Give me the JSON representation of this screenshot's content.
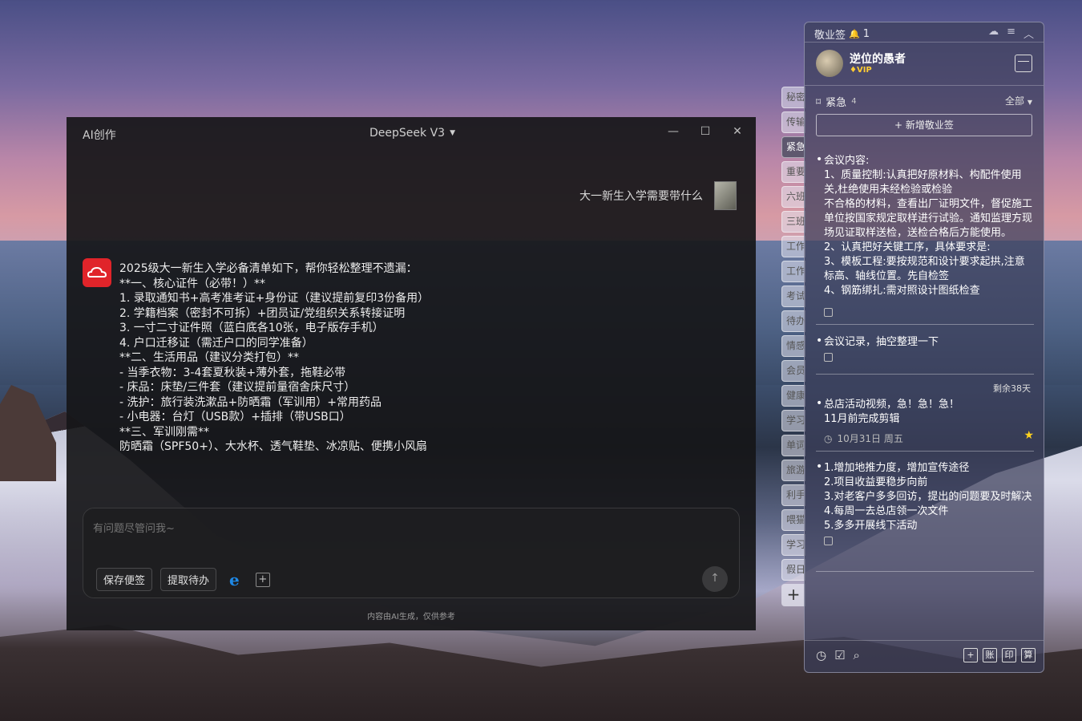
{
  "ai_window": {
    "title": "AI创作",
    "model": "DeepSeek V3",
    "user_message": "大一新生入学需要带什么",
    "response_lines": [
      "2025级大一新生入学必备清单如下，帮你轻松整理不遗漏：",
      "",
      "**一、核心证件（必带！）**",
      "1. 录取通知书+高考准考证+身份证（建议提前复印3份备用）",
      "2. 学籍档案（密封不可拆）+团员证/党组织关系转接证明",
      "3. 一寸二寸证件照（蓝白底各10张，电子版存手机）",
      "4. 户口迁移证（需迁户口的同学准备）",
      "",
      "**二、生活用品（建议分类打包）**",
      "- 当季衣物：3-4套夏秋装+薄外套，拖鞋必带",
      "- 床品：床垫/三件套（建议提前量宿舍床尺寸）",
      "- 洗护：旅行装洗漱品+防晒霜（军训用）+常用药品",
      "- 小电器：台灯（USB款）+插排（带USB口）",
      "",
      "**三、军训刚需**",
      "防晒霜（SPF50+）、大水杯、透气鞋垫、冰凉贴、便携小风扇"
    ],
    "input_placeholder": "有问题尽管问我~",
    "btn_save": "保存便签",
    "btn_extract": "提取待办",
    "footer": "内容由AI生成，仅供参考"
  },
  "side_tabs": [
    "秘密",
    "传输",
    "紧急",
    "重要",
    "六班",
    "三班",
    "工作",
    "工作",
    "考试",
    "待办",
    "情感",
    "会员",
    "健康",
    "学习",
    "单词",
    "旅游",
    "利手",
    "喂猫",
    "学习",
    "假日"
  ],
  "side_active_index": 2,
  "notes_panel": {
    "app_name": "敬业签",
    "notif_count": "1",
    "username": "逆位的愚者",
    "vip": "VIP",
    "category": "紧急",
    "category_count": "4",
    "filter": "全部",
    "new_note": "新增敬业签",
    "notes": [
      {
        "text": "会议内容:\n1、质量控制:认真把好原材料、构配件使用关,杜绝使用未经检验或检验\n不合格的材料，查看出厂证明文件，督促施工单位按国家规定取样进行试验。通知监理方现场见证取样送检，送检合格后方能使用。\n2、认真把好关键工序，具体要求是:\n3、模板工程:要按规范和设计要求起拱,注意标高、轴线位置。先自检签\n4、钢筋绑扎:需对照设计图纸检查"
      },
      {
        "text": "会议记录，抽空整理一下"
      },
      {
        "text": "总店活动视频，急！急！急！\n11月前完成剪辑",
        "remain": "剩余38天",
        "due": "10月31日 周五"
      },
      {
        "text": "1.增加地推力度，增加宣传途径\n2.项目收益要稳步向前\n3.对老客户多多回访，提出的问题要及时解决\n4.每周一去总店领一次文件\n5.多多开展线下活动"
      }
    ],
    "footer_tools": [
      "账",
      "印",
      "算"
    ]
  }
}
